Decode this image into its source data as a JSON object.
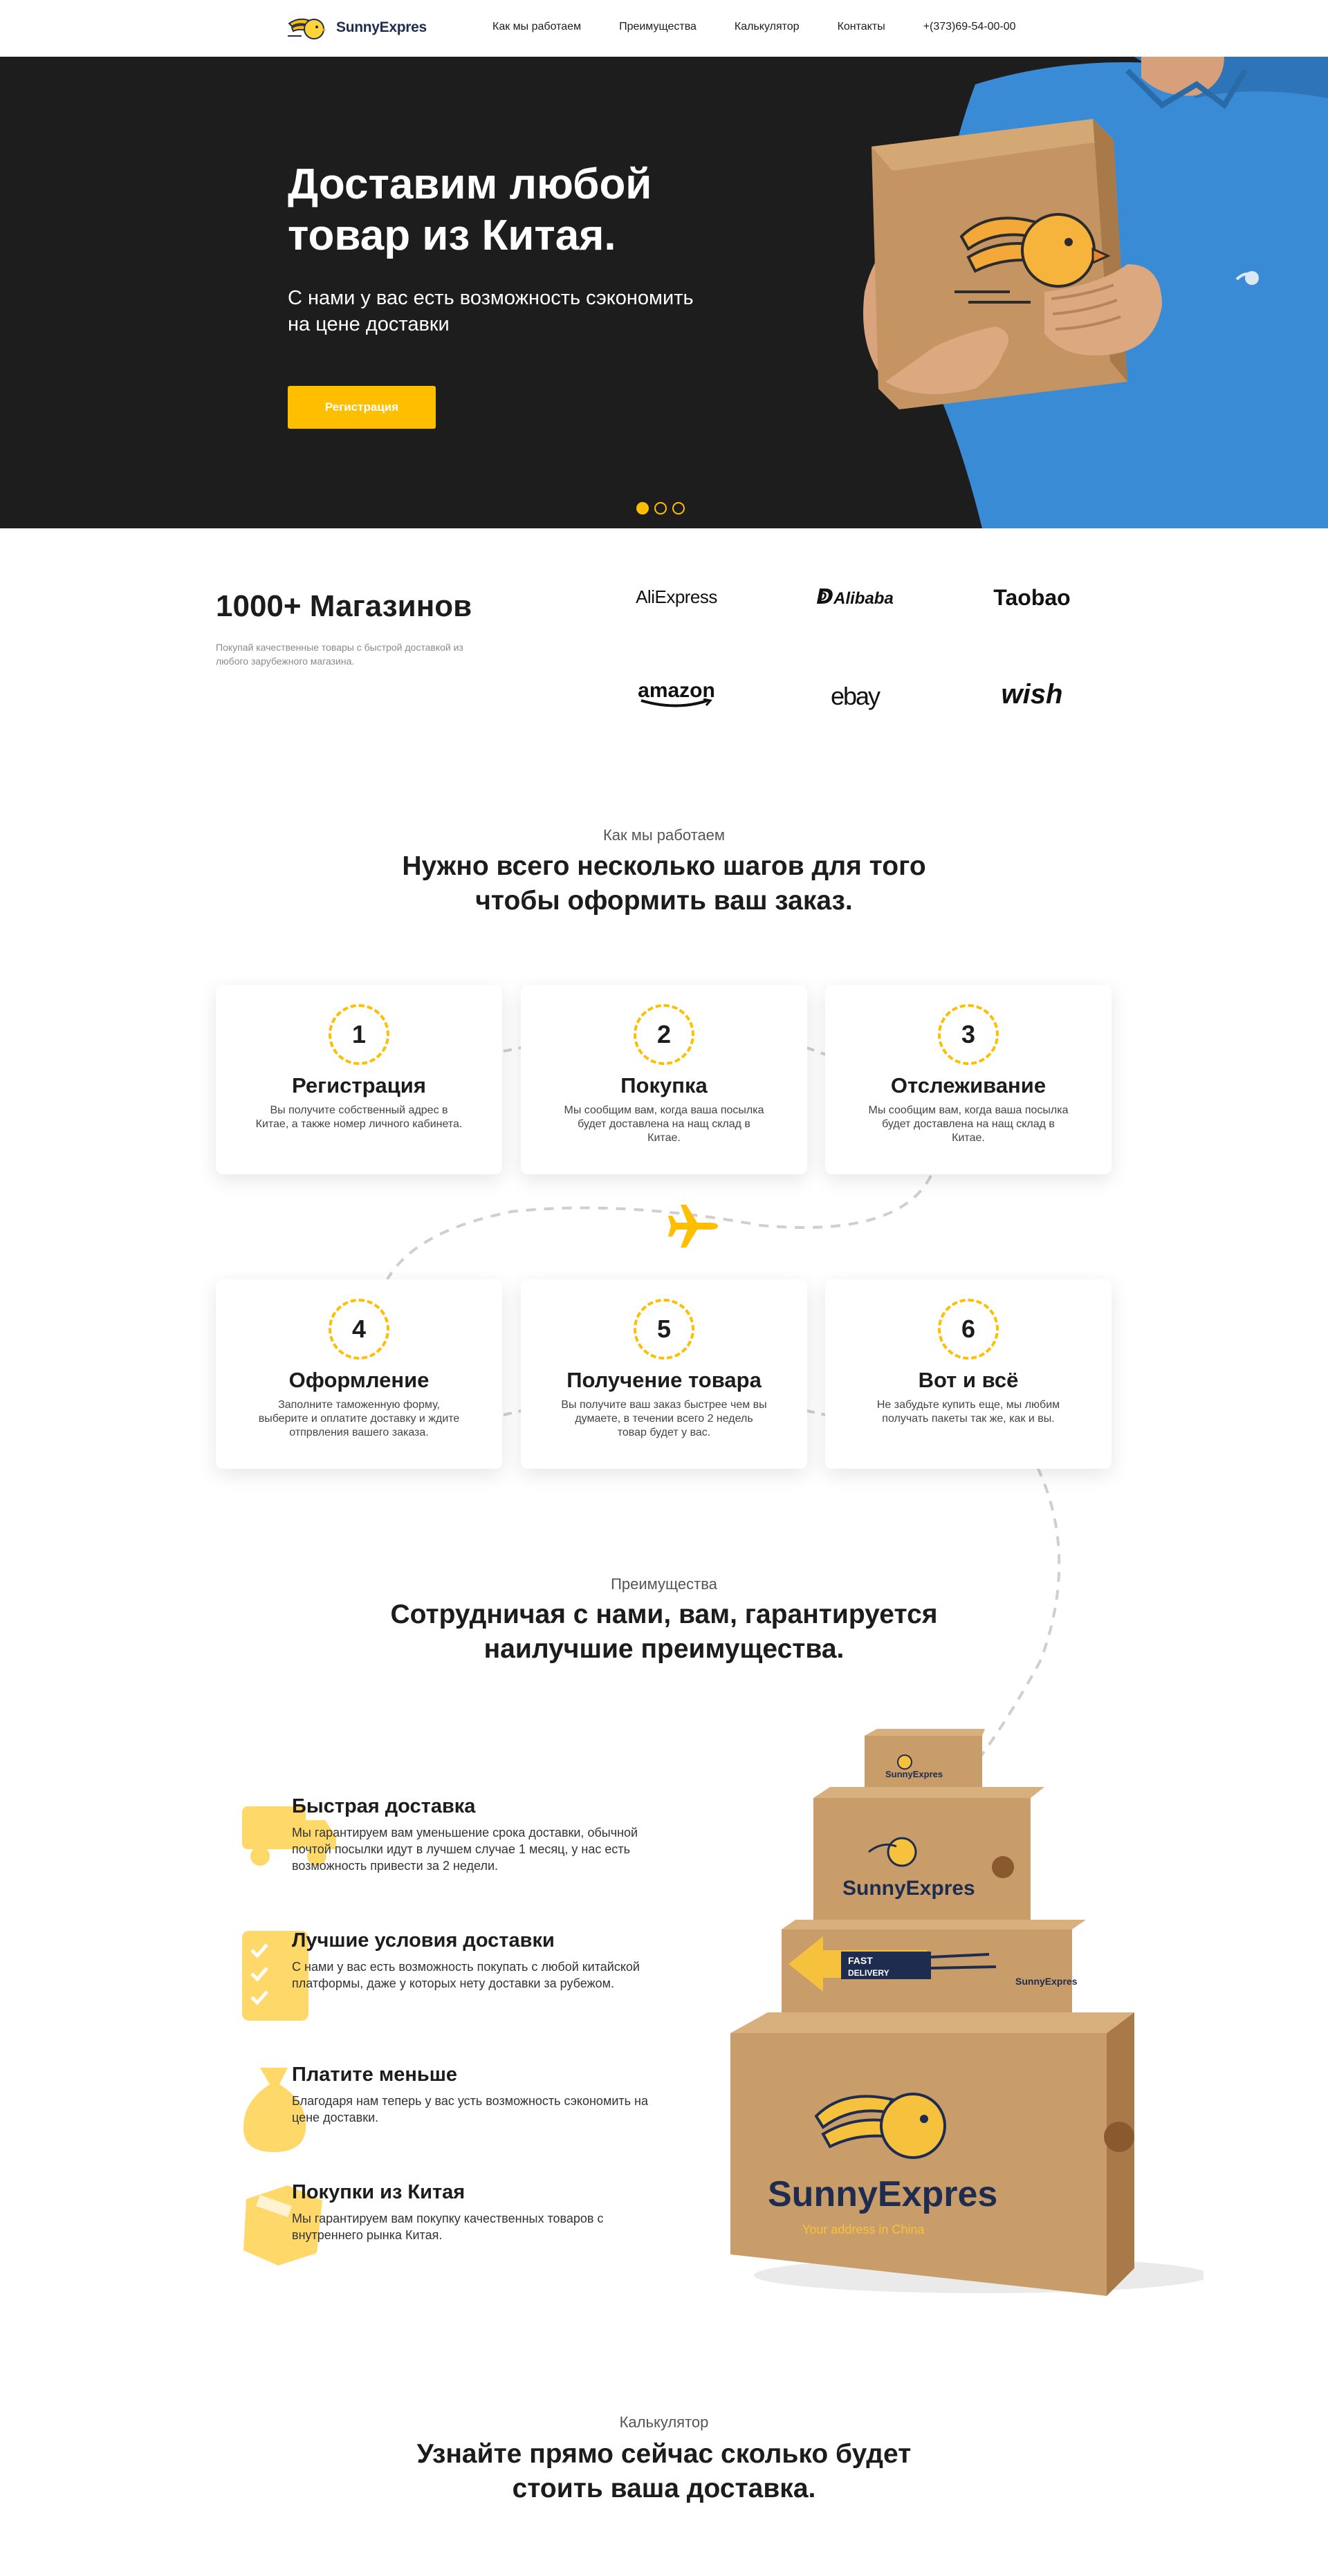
{
  "nav": {
    "brand": "SunnyExpres",
    "links": [
      "Как мы работаем",
      "Преимущества",
      "Калькулятор",
      "Контакты"
    ],
    "phone": "+(373)69-54-00-00"
  },
  "hero": {
    "title": "Доставим любой\nтовар из Китая.",
    "subtitle": "С нами у вас есть возможность сэкономить\nна цене доставки",
    "button": "Регистрация",
    "active_slide": 1,
    "slides": 3
  },
  "stores": {
    "title": "1000+ Магазинов",
    "subtitle": "Покупай качественные товары с быстрой доставкой из любого зарубежного магазина.",
    "brands": [
      "AliExpress",
      "Alibaba",
      "Taobao",
      "amazon",
      "ebay",
      "wish"
    ]
  },
  "how": {
    "kicker": "Как мы работаем",
    "heading": "Нужно всего несколько шагов для того\nчтобы оформить ваш заказ.",
    "steps": [
      {
        "num": "1",
        "title": "Регистрация",
        "text": "Вы получите собственный адрес в Китае, а также номер личного кабинета."
      },
      {
        "num": "2",
        "title": "Покупка",
        "text": "Мы сообщим вам, когда ваша посылка будет доставлена на нащ склад в Китае."
      },
      {
        "num": "3",
        "title": "Отслеживание",
        "text": "Мы сообщим вам, когда ваша посылка будет доставлена на нащ склад в Китае."
      },
      {
        "num": "4",
        "title": "Оформление",
        "text": "Заполните таможенную форму, выберите и оплатите доставку и ждите отпрвления вашего заказа."
      },
      {
        "num": "5",
        "title": "Получение товара",
        "text": "Вы получите ваш заказ быстрее чем вы думаете, в течении всего 2 недель товар будет у вас."
      },
      {
        "num": "6",
        "title": "Вот и всё",
        "text": "Не забудьте купить еще, мы любим получать пакеты так же, как и вы."
      }
    ]
  },
  "benefits": {
    "kicker": "Преимущества",
    "heading": "Сотрудничая с нами, вам, гарантируется\nнаилучшие преимущества.",
    "items": [
      {
        "title": "Быстрая доставка",
        "text": "Мы гарантируем вам уменьшение срока доставки, обычной почтой посылки идут в лучшем случае 1 месяц, у нас есть возможность привести за 2 недели.",
        "icon": "truck-icon"
      },
      {
        "title": "Лучшие условия доставки",
        "text": "С нами у вас есть возможность покупать с любой китайской платформы, даже у которых нету доставки за рубежом.",
        "icon": "checklist-icon"
      },
      {
        "title": "Платите меньше",
        "text": "Благодаря нам теперь у вас усть возможность сэкономить на цене доставки.",
        "icon": "money-bag-icon"
      },
      {
        "title": "Покупки из Китая",
        "text": "Мы гарантируем вам покупку качественных товаров с внутреннего рынка Китая.",
        "icon": "box-icon"
      }
    ],
    "box_labels": {
      "brand": "SunnyExpres",
      "tagline": "Your address in China",
      "fast": "FAST",
      "delivery": "DELIVERY"
    }
  },
  "calc": {
    "kicker": "Калькулятор",
    "heading": "Узнайте прямо сейчас сколько будет\nстоить ваша доставка."
  },
  "colors": {
    "accent": "#ffbf00",
    "dark": "#1d1d1d",
    "navy": "#1e2c4f",
    "cardboard": "#c9a06a"
  }
}
